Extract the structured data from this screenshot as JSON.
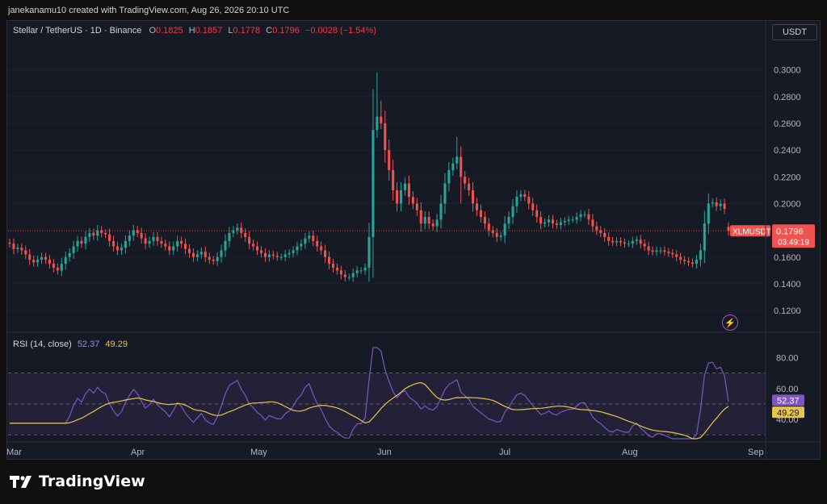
{
  "header": {
    "attribution": "janekanamu10 created with TradingView.com, Aug 26, 2026 20:10 UTC"
  },
  "legend": {
    "symbol": "Stellar / TetherUS · 1D · Binance",
    "o_label": "O",
    "o_value": "0.1825",
    "h_label": "H",
    "h_value": "0.1857",
    "l_label": "L",
    "l_value": "0.1778",
    "c_label": "C",
    "c_value": "0.1796",
    "change": "−0.0028 (−1.54%)"
  },
  "currency_button": "USDT",
  "price_label": {
    "ticker": "XLMUSDT",
    "price": "0.1796",
    "countdown": "03:49:19"
  },
  "rsi_legend": {
    "label": "RSI (14, close)",
    "rsi_value": "52.37",
    "ma_value": "49.29"
  },
  "branding": {
    "logo_text": "TradingView"
  },
  "colors": {
    "up": "#26a69a",
    "down": "#ef5350",
    "rsi_line": "#7e57c2",
    "rsi_ma": "#e8c547",
    "background": "#161a25"
  },
  "chart_data": [
    {
      "type": "candlestick",
      "title": "Stellar / TetherUS · 1D · Binance",
      "y_ticks": [
        "0.3000",
        "0.2800",
        "0.2600",
        "0.2400",
        "0.2200",
        "0.2000",
        "0.1600",
        "0.1400",
        "0.1200"
      ],
      "ylim": [
        0.108,
        0.31
      ],
      "x_ticks": [
        "Mar",
        "Apr",
        "May",
        "Jun",
        "Jul",
        "Aug",
        "Sep"
      ],
      "current_price": 0.1796,
      "close": [
        0.17,
        0.166,
        0.167,
        0.165,
        0.162,
        0.158,
        0.156,
        0.158,
        0.16,
        0.158,
        0.155,
        0.152,
        0.15,
        0.155,
        0.16,
        0.163,
        0.168,
        0.172,
        0.17,
        0.175,
        0.178,
        0.176,
        0.18,
        0.178,
        0.177,
        0.172,
        0.168,
        0.165,
        0.167,
        0.172,
        0.176,
        0.18,
        0.178,
        0.174,
        0.17,
        0.172,
        0.175,
        0.172,
        0.17,
        0.168,
        0.165,
        0.168,
        0.172,
        0.17,
        0.166,
        0.163,
        0.16,
        0.162,
        0.164,
        0.16,
        0.158,
        0.157,
        0.16,
        0.165,
        0.172,
        0.178,
        0.18,
        0.182,
        0.178,
        0.175,
        0.17,
        0.168,
        0.165,
        0.163,
        0.16,
        0.162,
        0.161,
        0.16,
        0.16,
        0.162,
        0.163,
        0.165,
        0.168,
        0.17,
        0.174,
        0.176,
        0.172,
        0.168,
        0.165,
        0.16,
        0.155,
        0.152,
        0.15,
        0.147,
        0.145,
        0.145,
        0.148,
        0.15,
        0.15,
        0.152,
        0.175,
        0.255,
        0.265,
        0.26,
        0.24,
        0.225,
        0.21,
        0.2,
        0.21,
        0.215,
        0.205,
        0.2,
        0.195,
        0.185,
        0.19,
        0.185,
        0.183,
        0.188,
        0.2,
        0.215,
        0.225,
        0.23,
        0.235,
        0.22,
        0.215,
        0.21,
        0.2,
        0.195,
        0.19,
        0.185,
        0.18,
        0.178,
        0.175,
        0.176,
        0.185,
        0.19,
        0.198,
        0.205,
        0.207,
        0.205,
        0.2,
        0.195,
        0.19,
        0.185,
        0.186,
        0.188,
        0.185,
        0.184,
        0.186,
        0.187,
        0.188,
        0.188,
        0.19,
        0.192,
        0.192,
        0.188,
        0.183,
        0.18,
        0.178,
        0.175,
        0.172,
        0.171,
        0.172,
        0.171,
        0.17,
        0.17,
        0.172,
        0.173,
        0.17,
        0.168,
        0.165,
        0.164,
        0.165,
        0.165,
        0.164,
        0.163,
        0.162,
        0.16,
        0.158,
        0.157,
        0.156,
        0.155,
        0.158,
        0.165,
        0.185,
        0.2,
        0.201,
        0.198,
        0.2,
        0.196,
        0.1796
      ]
    },
    {
      "type": "line",
      "title": "RSI (14, close)",
      "y_ticks": [
        "80.00",
        "60.00",
        "40.00"
      ],
      "ylim": [
        27,
        87
      ],
      "bands": {
        "upper": 70,
        "middle": 50,
        "lower": 30
      },
      "series": [
        {
          "name": "RSI",
          "last": 52.37
        },
        {
          "name": "RSI-based MA",
          "last": 49.29
        }
      ]
    }
  ]
}
